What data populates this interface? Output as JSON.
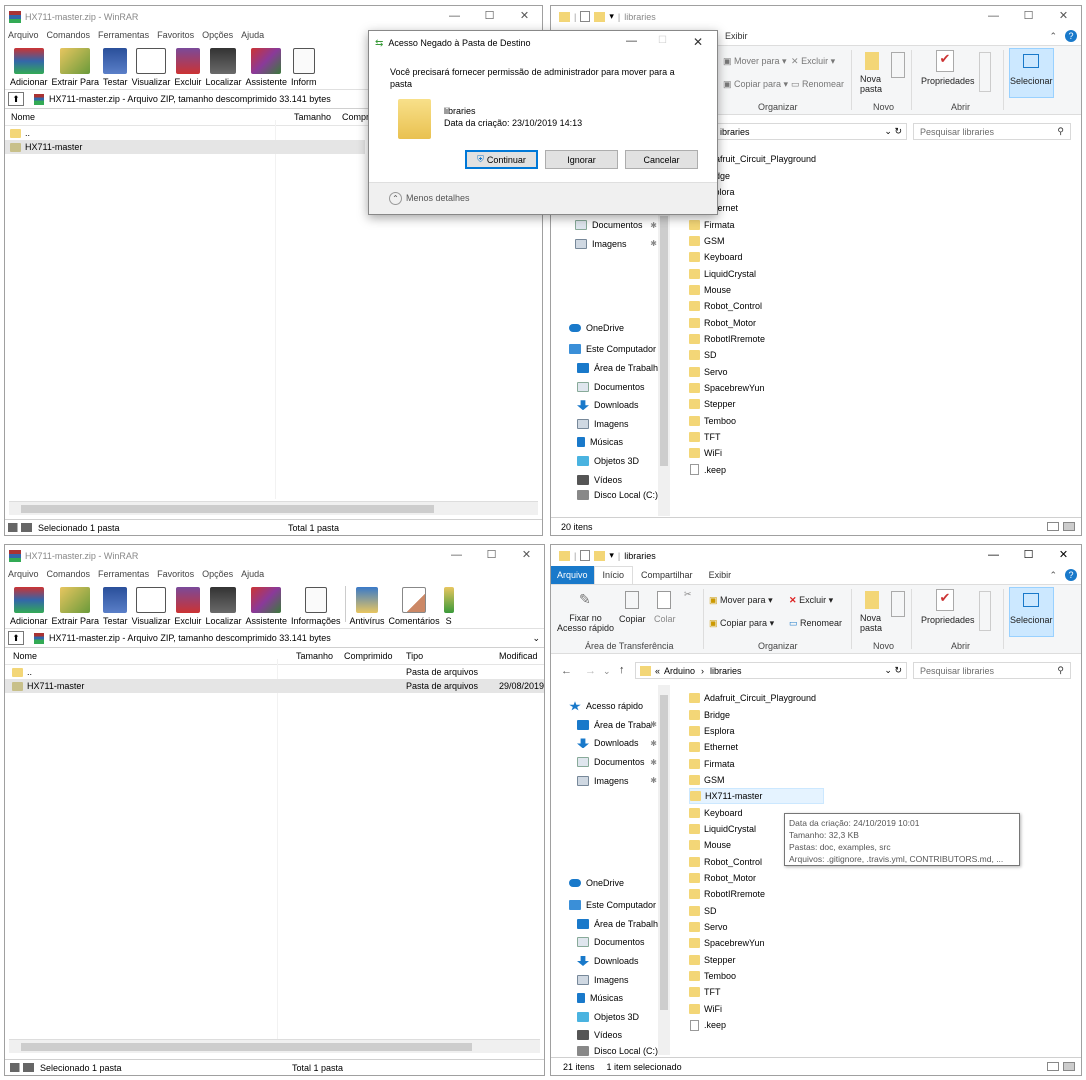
{
  "winrar_top": {
    "title": "HX711-master.zip - WinRAR",
    "menu": [
      "Arquivo",
      "Comandos",
      "Ferramentas",
      "Favoritos",
      "Opções",
      "Ajuda"
    ],
    "tools": [
      "Adicionar",
      "Extrair Para",
      "Testar",
      "Visualizar",
      "Excluir",
      "Localizar",
      "Assistente",
      "Inform"
    ],
    "address": "HX711-master.zip - Arquivo ZIP, tamanho descomprimido 33.141 bytes",
    "columns": [
      "Nome",
      "Tamanho",
      "Compr"
    ],
    "rows": [
      "..",
      "HX711-master"
    ],
    "status_left": "Selecionado 1 pasta",
    "status_right": "Total 1 pasta"
  },
  "winrar_bottom": {
    "title": "HX711-master.zip - WinRAR",
    "menu": [
      "Arquivo",
      "Comandos",
      "Ferramentas",
      "Favoritos",
      "Opções",
      "Ajuda"
    ],
    "tools": [
      "Adicionar",
      "Extrair Para",
      "Testar",
      "Visualizar",
      "Excluir",
      "Localizar",
      "Assistente",
      "Informações",
      "Antivírus",
      "Comentários",
      "S"
    ],
    "address": "HX711-master.zip - Arquivo ZIP, tamanho descomprimido 33.141 bytes",
    "columns": [
      "Nome",
      "Tamanho",
      "Comprimido",
      "Tipo",
      "Modificad"
    ],
    "rows": [
      {
        "name": "..",
        "type": "Pasta de arquivos",
        "date": ""
      },
      {
        "name": "HX711-master",
        "type": "Pasta de arquivos",
        "date": "29/08/2019"
      }
    ],
    "status_left": "Selecionado 1 pasta",
    "status_right": "Total 1 pasta"
  },
  "explorer_top": {
    "title": "libraries",
    "tab_visible": "Exibir",
    "ribbon": {
      "mover": "Mover para",
      "excluir": "Excluir",
      "copiar": "Copiar para",
      "renomear": "Renomear",
      "nova": "Nova",
      "pasta": "pasta",
      "propriedades": "Propriedades",
      "selecionar": "Selecionar",
      "g_organizar": "Organizar",
      "g_novo": "Novo",
      "g_abrir": "Abrir"
    },
    "address": "ibraries",
    "search": "Pesquisar libraries",
    "nav": [
      {
        "label": "Documentos",
        "pin": "✱"
      },
      {
        "label": "Imagens",
        "pin": "✱"
      },
      {
        "label": "OneDrive"
      },
      {
        "label": "Este Computador"
      },
      {
        "label": "Área de Trabalho"
      },
      {
        "label": "Documentos"
      },
      {
        "label": "Downloads"
      },
      {
        "label": "Imagens"
      },
      {
        "label": "Músicas"
      },
      {
        "label": "Objetos 3D"
      },
      {
        "label": "Vídeos"
      },
      {
        "label": "Disco Local (C:)"
      }
    ],
    "files": [
      "Adafruit_Circuit_Playground",
      "Bridge",
      "Esplora",
      "Ethernet",
      "Firmata",
      "GSM",
      "Keyboard",
      "LiquidCrystal",
      "Mouse",
      "Robot_Control",
      "Robot_Motor",
      "RobotIRremote",
      "SD",
      "Servo",
      "SpacebrewYun",
      "Stepper",
      "Temboo",
      "TFT",
      "WiFi",
      ".keep"
    ],
    "status": "20 itens"
  },
  "explorer_bottom": {
    "title": "libraries",
    "tabs": [
      "Arquivo",
      "Início",
      "Compartilhar",
      "Exibir"
    ],
    "ribbon": {
      "fixar": "Fixar no",
      "acesso": "Acesso rápido",
      "copiar": "Copiar",
      "colar": "Colar",
      "mover": "Mover para",
      "excluir": "Excluir",
      "copiar_para": "Copiar para",
      "renomear": "Renomear",
      "nova": "Nova",
      "pasta": "pasta",
      "propriedades": "Propriedades",
      "selecionar": "Selecionar",
      "g_transf": "Área de Transferência",
      "g_organizar": "Organizar",
      "g_novo": "Novo",
      "g_abrir": "Abrir"
    },
    "breadcrumb": [
      "«",
      "Arduino",
      "›",
      "libraries"
    ],
    "search": "Pesquisar libraries",
    "nav": [
      {
        "label": "Acesso rápido"
      },
      {
        "label": "Área de Trabalho",
        "pin": "✱"
      },
      {
        "label": "Downloads",
        "pin": "✱"
      },
      {
        "label": "Documentos",
        "pin": "✱"
      },
      {
        "label": "Imagens",
        "pin": "✱"
      },
      {
        "label": "OneDrive"
      },
      {
        "label": "Este Computador"
      },
      {
        "label": "Área de Trabalho"
      },
      {
        "label": "Documentos"
      },
      {
        "label": "Downloads"
      },
      {
        "label": "Imagens"
      },
      {
        "label": "Músicas"
      },
      {
        "label": "Objetos 3D"
      },
      {
        "label": "Vídeos"
      },
      {
        "label": "Disco Local (C:)"
      }
    ],
    "files": [
      "Adafruit_Circuit_Playground",
      "Bridge",
      "Esplora",
      "Ethernet",
      "Firmata",
      "GSM",
      "HX711-master",
      "Keyboard",
      "LiquidCrystal",
      "Mouse",
      "Robot_Control",
      "Robot_Motor",
      "RobotIRremote",
      "SD",
      "Servo",
      "SpacebrewYun",
      "Stepper",
      "Temboo",
      "TFT",
      "WiFi",
      ".keep"
    ],
    "status_count": "21 itens",
    "status_sel": "1 item selecionado",
    "tooltip": [
      "Data da criação: 24/10/2019 10:01",
      "Tamanho: 32,3 KB",
      "Pastas: doc, examples, src",
      "Arquivos: .gitignore, .travis.yml, CONTRIBUTORS.md, ..."
    ]
  },
  "dialog": {
    "title": "Acesso Negado à Pasta de Destino",
    "message": "Você precisará fornecer permissão de administrador para mover para a pasta",
    "folder_name": "libraries",
    "folder_date": "Data da criação: 23/10/2019 14:13",
    "btn_continue": "Continuar",
    "btn_ignore": "Ignorar",
    "btn_cancel": "Cancelar",
    "details": "Menos detalhes"
  }
}
